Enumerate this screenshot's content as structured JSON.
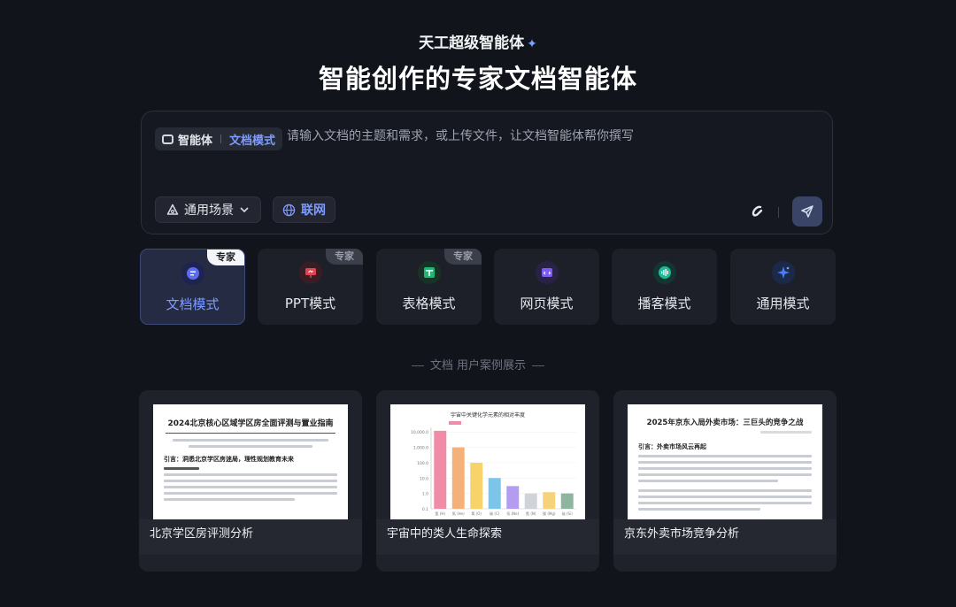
{
  "header": {
    "brand": "天工超级智能体",
    "headline": "智能创作的专家文档智能体"
  },
  "composer": {
    "agent_label": "智能体",
    "mode_label": "文档模式",
    "placeholder": "请输入文档的主题和需求，或上传文件，让文档智能体帮你撰写",
    "value": "",
    "scene_label": "通用场景",
    "web_label": "联网"
  },
  "modes": [
    {
      "label": "文档模式",
      "badge": "专家",
      "active": true,
      "color": "#5b6cf0"
    },
    {
      "label": "PPT模式",
      "badge": "专家",
      "active": false,
      "color": "#e0454f"
    },
    {
      "label": "表格模式",
      "badge": "专家",
      "active": false,
      "color": "#22b573"
    },
    {
      "label": "网页模式",
      "badge": "",
      "active": false,
      "color": "#7c5cf0"
    },
    {
      "label": "播客模式",
      "badge": "",
      "active": false,
      "color": "#1fb89a"
    },
    {
      "label": "通用模式",
      "badge": "",
      "active": false,
      "color": "#4a7dff"
    }
  ],
  "cases_title": "文档 用户案例展示",
  "cases": [
    {
      "label": "北京学区房评测分析",
      "doc_title": "2024北京核心区域学区房全面评测与置业指南",
      "doc_heading": "引言：洞悉北京学区房迷局，理性规划教育未来"
    },
    {
      "label": "宇宙中的类人生命探索",
      "doc_title": "宇宙中关键化学元素的相对丰度"
    },
    {
      "label": "京东外卖市场竞争分析",
      "doc_title": "2025年京东入局外卖市场：三巨头的竞争之战",
      "doc_heading": "引言：外卖市场风云再起"
    }
  ],
  "chart_data": {
    "type": "bar",
    "title": "宇宙中关键化学元素的相对丰度",
    "categories": [
      "氢 (H)",
      "氦 (He)",
      "氧 (O)",
      "碳 (C)",
      "氖 (Ne)",
      "氮 (N)",
      "镁 (Mg)",
      "硅 (Si)"
    ],
    "values": [
      12000,
      1000,
      100,
      10,
      3,
      1,
      1.2,
      1
    ],
    "y_ticks": [
      "10,000.0",
      "1,000.0",
      "100.0",
      "10.0",
      "1.0",
      "0.1"
    ],
    "y_scale": "log",
    "colors": [
      "#f08ca8",
      "#f4b27a",
      "#f8d26a",
      "#7cc4e8",
      "#b49cf0",
      "#d0d3d8",
      "#f6d27a",
      "#8fb4a0"
    ]
  }
}
